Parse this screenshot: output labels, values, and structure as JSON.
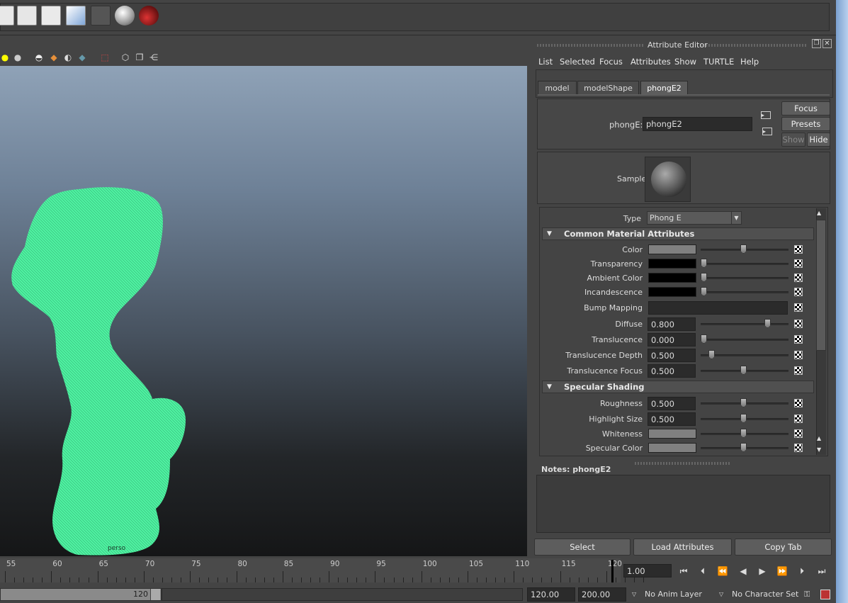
{
  "attribute_editor": {
    "title": "Attribute Editor",
    "menu": [
      "List",
      "Selected",
      "Focus",
      "Attributes",
      "Show",
      "TURTLE",
      "Help"
    ],
    "tabs": [
      "model",
      "modelShape",
      "phongE2"
    ],
    "node_label": "phongE:",
    "node_name": "phongE2",
    "focus_button": "Focus",
    "presets_button": "Presets",
    "show_button": "Show",
    "hide_button": "Hide",
    "sample_label": "Sample",
    "type_label": "Type",
    "type_value": "Phong E",
    "common_section": "Common Material Attributes",
    "common": [
      {
        "label": "Color",
        "kind": "swatch",
        "color": "#808080",
        "slider": 0.5
      },
      {
        "label": "Transparency",
        "kind": "swatch",
        "color": "#000000",
        "slider": 0.0
      },
      {
        "label": "Ambient Color",
        "kind": "swatch",
        "color": "#000000",
        "slider": 0.0
      },
      {
        "label": "Incandescence",
        "kind": "swatch",
        "color": "#000000",
        "slider": 0.0
      },
      {
        "label": "Bump Mapping",
        "kind": "bump"
      },
      {
        "label": "Diffuse",
        "kind": "value",
        "value": "0.800",
        "slider": 0.8
      },
      {
        "label": "Translucence",
        "kind": "value",
        "value": "0.000",
        "slider": 0.0
      },
      {
        "label": "Translucence Depth",
        "kind": "value",
        "value": "0.500",
        "slider": 0.1
      },
      {
        "label": "Translucence Focus",
        "kind": "value",
        "value": "0.500",
        "slider": 0.5
      }
    ],
    "specular_section": "Specular Shading",
    "specular": [
      {
        "label": "Roughness",
        "kind": "value",
        "value": "0.500",
        "slider": 0.5
      },
      {
        "label": "Highlight Size",
        "kind": "value",
        "value": "0.500",
        "slider": 0.5
      },
      {
        "label": "Whiteness",
        "kind": "swatch",
        "color": "#808080",
        "slider": 0.5
      },
      {
        "label": "Specular Color",
        "kind": "swatch",
        "color": "#808080",
        "slider": 0.5
      }
    ],
    "notes_label": "Notes:  phongE2",
    "select_button": "Select",
    "load_button": "Load Attributes",
    "copy_button": "Copy Tab"
  },
  "viewport": {
    "object_label": "perso",
    "mesh_color": "#4ef0a0"
  },
  "timeline": {
    "ticks": [
      "55",
      "60",
      "65",
      "70",
      "75",
      "80",
      "85",
      "90",
      "95",
      "100",
      "105",
      "110",
      "115",
      "120"
    ],
    "current_frame": "1.00"
  },
  "range": {
    "end_in_bar": "120",
    "anim_end": "120.00",
    "playback_end": "200.00",
    "anim_layer": "No Anim Layer",
    "character_set": "No Character Set"
  }
}
